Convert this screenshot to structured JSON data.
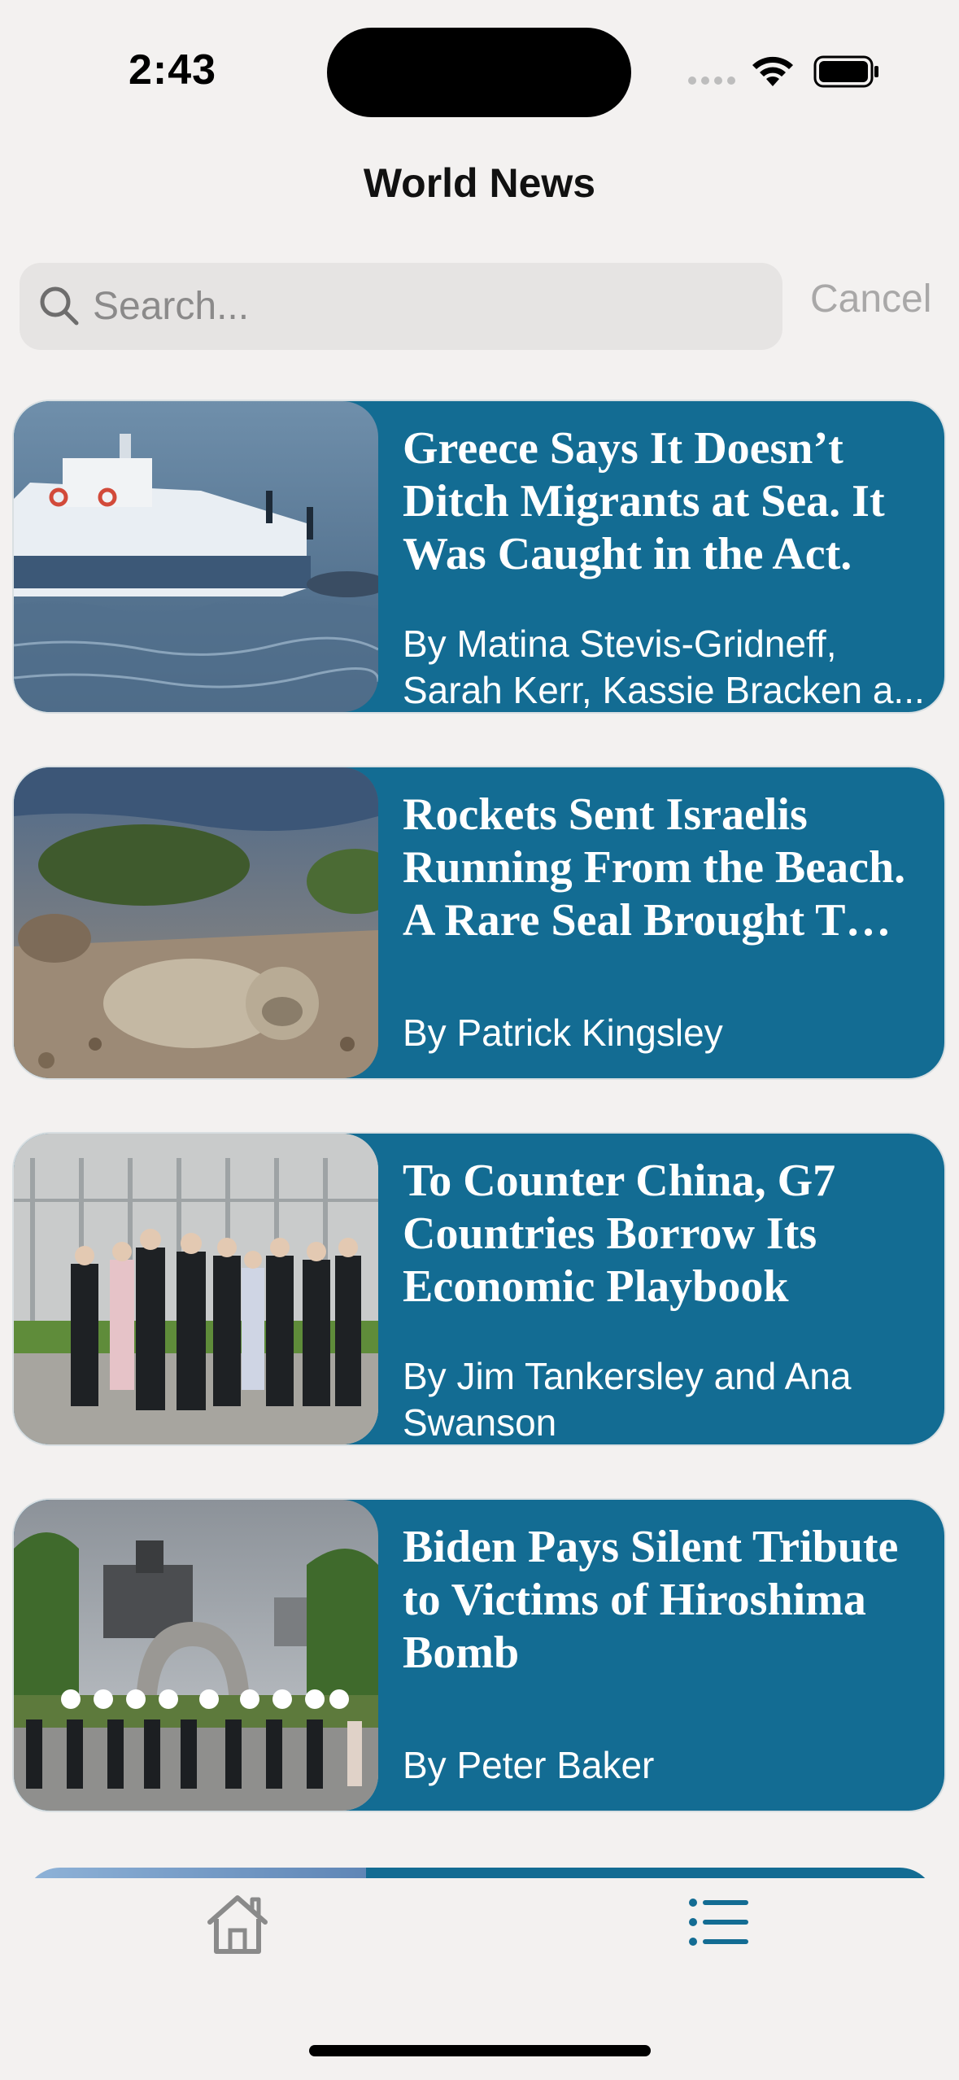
{
  "status_bar": {
    "time": "2:43"
  },
  "nav": {
    "title": "World News"
  },
  "search": {
    "placeholder": "Search...",
    "cancel_label": "Cancel"
  },
  "articles": [
    {
      "title": "Greece Says It Doesn’t Ditch Migrants at Sea. It Was Caught in the Act.",
      "byline": "By Matina Stevis-Gridneff, Sarah Kerr, Kassie Bracken a..."
    },
    {
      "title": "Rockets Sent Israelis Running From the Beach. A Rare Seal Brought T…",
      "byline": "By Patrick Kingsley"
    },
    {
      "title": "To Counter China, G7 Countries Borrow Its Economic Playbook",
      "byline": "By Jim Tankersley and Ana Swanson"
    },
    {
      "title": "Biden Pays Silent Tribute to Victims of Hiroshima Bomb",
      "byline": "By Peter Baker"
    }
  ],
  "colors": {
    "card_bg": "#136c93",
    "accent": "#136c93",
    "page_bg": "#f3f1f0"
  },
  "tabs": [
    {
      "icon": "house-icon",
      "selected": false
    },
    {
      "icon": "list-icon",
      "selected": true
    }
  ]
}
